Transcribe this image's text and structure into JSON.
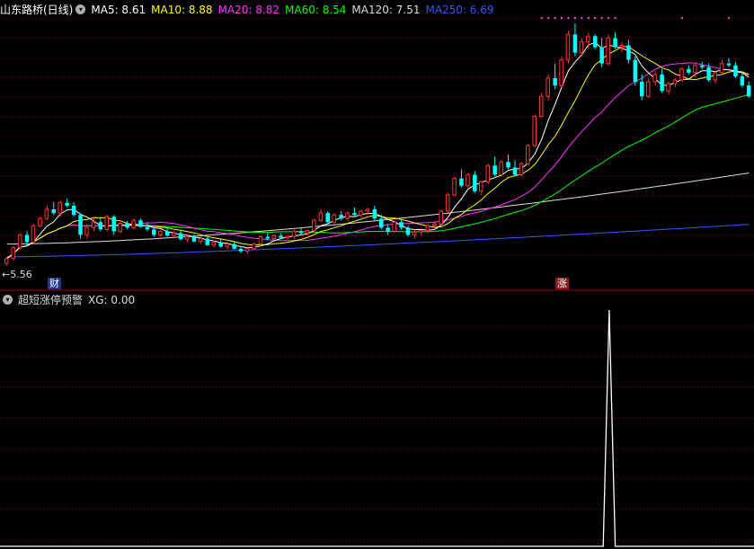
{
  "main_panel": {
    "title": "山东路桥(日线)",
    "indicators": [
      {
        "label": "MA5: 8.61",
        "color": "#ffffff"
      },
      {
        "label": "MA10: 8.88",
        "color": "#ffff00"
      },
      {
        "label": "MA20: 8.82",
        "color": "#ff33ff"
      },
      {
        "label": "MA60: 8.54",
        "color": "#00ff00"
      },
      {
        "label": "MA120: 7.51",
        "color": "#dddddd"
      },
      {
        "label": "MA250: 6.69",
        "color": "#3355ff"
      }
    ],
    "low_price_label": "5.56",
    "event_badge_1": "财",
    "event_badge_2": "涨"
  },
  "sub_panel": {
    "title": "超短涨停预警",
    "value_label": "XG: 0.00"
  },
  "colors": {
    "up": "#ff3333",
    "down": "#00ffff",
    "grid": "#8b0000",
    "ma5": "#ffffff",
    "ma10": "#ffff00",
    "ma20": "#ff33ff",
    "ma60": "#00ff00",
    "ma120": "#dddddd",
    "ma250": "#3355ff",
    "signal": "#ffffff"
  },
  "chart_data": {
    "type": "candlestick",
    "candles": [
      [
        5.62,
        5.8,
        5.56,
        5.75
      ],
      [
        5.75,
        6.1,
        5.7,
        6.05
      ],
      [
        6.05,
        6.45,
        6.0,
        6.4
      ],
      [
        6.4,
        6.5,
        6.1,
        6.2
      ],
      [
        6.2,
        6.7,
        6.15,
        6.65
      ],
      [
        6.65,
        6.9,
        6.6,
        6.85
      ],
      [
        6.85,
        7.2,
        6.8,
        7.1
      ],
      [
        7.1,
        7.3,
        6.95,
        7.0
      ],
      [
        7.0,
        7.35,
        6.9,
        7.28
      ],
      [
        7.28,
        7.4,
        7.15,
        7.2
      ],
      [
        7.2,
        7.3,
        6.9,
        6.95
      ],
      [
        6.95,
        7.0,
        6.3,
        6.4
      ],
      [
        6.4,
        6.7,
        6.3,
        6.6
      ],
      [
        6.6,
        6.85,
        6.5,
        6.75
      ],
      [
        6.75,
        6.9,
        6.5,
        6.55
      ],
      [
        6.55,
        6.95,
        6.5,
        6.9
      ],
      [
        6.9,
        6.95,
        6.4,
        6.5
      ],
      [
        6.5,
        6.8,
        6.45,
        6.72
      ],
      [
        6.72,
        6.78,
        6.55,
        6.6
      ],
      [
        6.6,
        6.85,
        6.55,
        6.8
      ],
      [
        6.8,
        6.85,
        6.6,
        6.62
      ],
      [
        6.62,
        6.75,
        6.5,
        6.55
      ],
      [
        6.55,
        6.65,
        6.35,
        6.4
      ],
      [
        6.4,
        6.55,
        6.3,
        6.5
      ],
      [
        6.5,
        6.6,
        6.35,
        6.38
      ],
      [
        6.38,
        6.5,
        6.3,
        6.45
      ],
      [
        6.45,
        6.52,
        6.25,
        6.28
      ],
      [
        6.28,
        6.4,
        6.2,
        6.35
      ],
      [
        6.35,
        6.42,
        6.2,
        6.22
      ],
      [
        6.22,
        6.35,
        6.15,
        6.3
      ],
      [
        6.3,
        6.35,
        6.1,
        6.12
      ],
      [
        6.12,
        6.25,
        6.05,
        6.2
      ],
      [
        6.2,
        6.28,
        6.05,
        6.08
      ],
      [
        6.08,
        6.2,
        6.0,
        6.15
      ],
      [
        6.15,
        6.22,
        6.0,
        6.02
      ],
      [
        6.02,
        6.1,
        5.9,
        5.95
      ],
      [
        5.95,
        6.05,
        5.88,
        6.02
      ],
      [
        6.02,
        6.2,
        5.98,
        6.15
      ],
      [
        6.15,
        6.4,
        6.1,
        6.35
      ],
      [
        6.35,
        6.45,
        6.25,
        6.3
      ],
      [
        6.3,
        6.42,
        6.25,
        6.38
      ],
      [
        6.38,
        6.45,
        6.28,
        6.32
      ],
      [
        6.32,
        6.4,
        6.25,
        6.36
      ],
      [
        6.36,
        6.55,
        6.3,
        6.5
      ],
      [
        6.5,
        6.6,
        6.4,
        6.45
      ],
      [
        6.45,
        6.55,
        6.38,
        6.52
      ],
      [
        6.52,
        6.85,
        6.48,
        6.8
      ],
      [
        6.8,
        7.1,
        6.75,
        7.0
      ],
      [
        7.0,
        7.05,
        6.7,
        6.75
      ],
      [
        6.75,
        7.0,
        6.7,
        6.95
      ],
      [
        6.95,
        7.05,
        6.8,
        6.85
      ],
      [
        6.85,
        7.05,
        6.8,
        7.0
      ],
      [
        7.0,
        7.15,
        6.9,
        6.95
      ],
      [
        6.95,
        7.1,
        6.88,
        7.05
      ],
      [
        7.05,
        7.15,
        6.95,
        7.1
      ],
      [
        7.1,
        7.2,
        6.8,
        6.85
      ],
      [
        6.85,
        6.95,
        6.55,
        6.6
      ],
      [
        6.6,
        6.7,
        6.4,
        6.5
      ],
      [
        6.5,
        6.8,
        6.45,
        6.75
      ],
      [
        6.75,
        6.82,
        6.55,
        6.6
      ],
      [
        6.6,
        6.65,
        6.35,
        6.4
      ],
      [
        6.4,
        6.55,
        6.3,
        6.48
      ],
      [
        6.48,
        6.58,
        6.38,
        6.52
      ],
      [
        6.52,
        6.7,
        6.45,
        6.65
      ],
      [
        6.65,
        6.8,
        6.55,
        6.7
      ],
      [
        6.7,
        7.1,
        6.65,
        7.05
      ],
      [
        7.05,
        7.55,
        7.0,
        7.5
      ],
      [
        7.5,
        8.0,
        7.45,
        7.95
      ],
      [
        7.95,
        8.2,
        7.7,
        7.75
      ],
      [
        7.75,
        8.1,
        7.7,
        8.05
      ],
      [
        8.05,
        8.15,
        7.55,
        7.6
      ],
      [
        7.6,
        7.9,
        7.5,
        7.85
      ],
      [
        7.85,
        8.35,
        7.8,
        8.3
      ],
      [
        8.3,
        8.55,
        8.0,
        8.05
      ],
      [
        8.05,
        8.45,
        8.0,
        8.4
      ],
      [
        8.4,
        8.6,
        8.2,
        8.25
      ],
      [
        8.25,
        8.45,
        8.0,
        8.05
      ],
      [
        8.05,
        8.4,
        8.0,
        8.35
      ],
      [
        8.35,
        8.9,
        8.3,
        8.85
      ],
      [
        8.85,
        9.7,
        8.8,
        9.65
      ],
      [
        9.65,
        10.3,
        9.6,
        10.2
      ],
      [
        10.2,
        10.8,
        10.1,
        10.7
      ],
      [
        10.7,
        11.1,
        10.4,
        10.5
      ],
      [
        10.5,
        11.3,
        10.45,
        11.2
      ],
      [
        11.2,
        12.0,
        11.1,
        11.9
      ],
      [
        11.9,
        12.2,
        11.3,
        11.4
      ],
      [
        11.4,
        11.8,
        11.3,
        11.7
      ],
      [
        11.7,
        11.95,
        11.5,
        11.85
      ],
      [
        11.85,
        11.9,
        11.5,
        11.55
      ],
      [
        11.55,
        11.8,
        11.0,
        11.1
      ],
      [
        11.1,
        11.9,
        11.05,
        11.8
      ],
      [
        11.8,
        11.95,
        11.5,
        11.55
      ],
      [
        11.55,
        11.7,
        11.4,
        11.6
      ],
      [
        11.6,
        11.75,
        11.1,
        11.2
      ],
      [
        11.2,
        11.3,
        10.5,
        10.6
      ],
      [
        10.6,
        10.8,
        10.1,
        10.2
      ],
      [
        10.2,
        10.7,
        10.15,
        10.6
      ],
      [
        10.6,
        10.9,
        10.5,
        10.8
      ],
      [
        10.8,
        10.95,
        10.3,
        10.35
      ],
      [
        10.35,
        10.6,
        10.25,
        10.55
      ],
      [
        10.55,
        10.7,
        10.45,
        10.65
      ],
      [
        10.65,
        11.0,
        10.6,
        10.95
      ],
      [
        10.95,
        11.05,
        10.8,
        10.85
      ],
      [
        10.85,
        11.1,
        10.7,
        11.05
      ],
      [
        11.05,
        11.15,
        10.95,
        11.0
      ],
      [
        11.0,
        11.1,
        10.6,
        10.65
      ],
      [
        10.65,
        10.9,
        10.55,
        10.85
      ],
      [
        10.85,
        11.2,
        10.8,
        11.1
      ],
      [
        11.1,
        11.25,
        11.0,
        11.05
      ],
      [
        11.05,
        11.15,
        10.7,
        10.75
      ],
      [
        10.75,
        10.85,
        10.45,
        10.5
      ],
      [
        10.5,
        10.6,
        10.15,
        10.2
      ]
    ],
    "ma_series": {
      "ma60_start": 6.7,
      "ma60_end": 9.85,
      "ma120_start": 6.15,
      "ma120_end": 8.1,
      "ma250_start": 5.8,
      "ma250_end": 6.69
    },
    "signal": {
      "type": "line",
      "x": [
        0,
        100,
        101,
        102,
        125
      ],
      "y": [
        0,
        0,
        1,
        0,
        0
      ],
      "spike_index": 101
    }
  }
}
